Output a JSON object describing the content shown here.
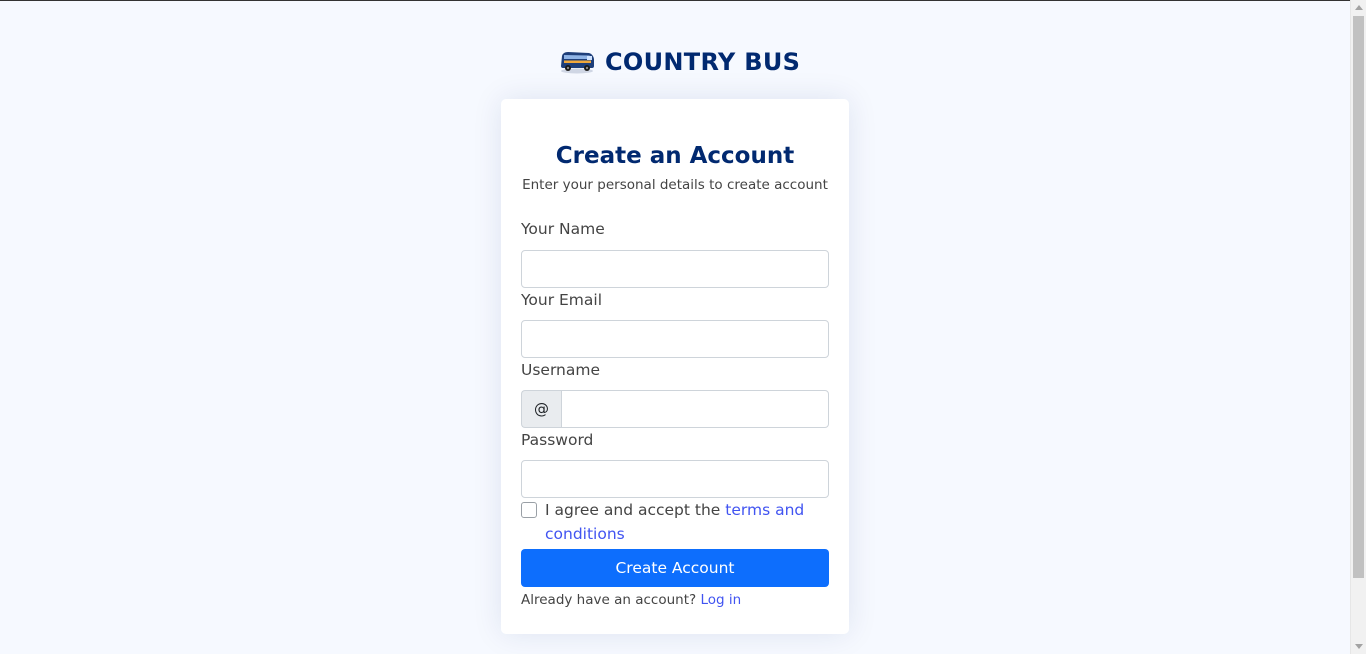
{
  "brand": {
    "name": "COUNTRY BUS",
    "logo_icon": "bus-icon"
  },
  "card": {
    "title": "Create an Account",
    "subtitle": "Enter your personal details to create account"
  },
  "form": {
    "name_label": "Your Name",
    "name_value": "",
    "email_label": "Your Email",
    "email_value": "",
    "username_label": "Username",
    "username_prefix": "@",
    "username_value": "",
    "password_label": "Password",
    "password_value": "",
    "terms_text": "I agree and accept the ",
    "terms_link": "terms and conditions",
    "terms_checked": false,
    "submit_label": "Create Account",
    "login_prompt": "Already have an account? ",
    "login_link": "Log in"
  },
  "colors": {
    "page_bg": "#f6f9ff",
    "brand": "#012970",
    "link": "#4154f1",
    "primary_button": "#0d6efd"
  }
}
